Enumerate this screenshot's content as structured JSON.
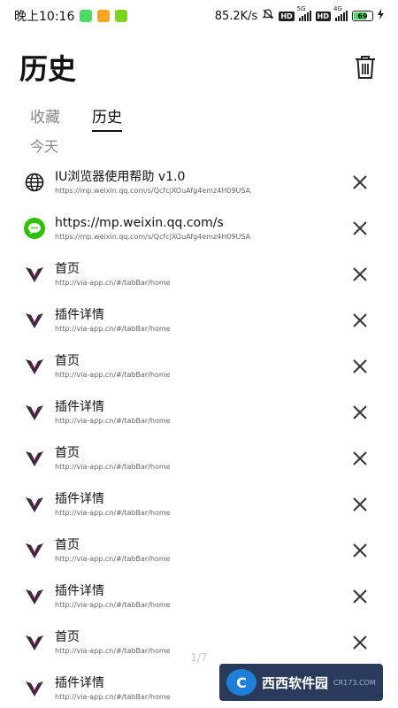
{
  "status_bar": {
    "time": "晚上10:16",
    "net_speed": "85.2K/s",
    "hd1": "HD",
    "sig1_label": "5G",
    "hd2": "HD",
    "sig2_label": "4G",
    "battery_level": 69,
    "battery_text": "69",
    "notif_colors": [
      "#4cd964",
      "#f5a623",
      "#7ed321"
    ]
  },
  "header": {
    "title": "历史",
    "trash_icon": "trash-icon"
  },
  "tabs": [
    {
      "label": "收藏",
      "active": false
    },
    {
      "label": "历史",
      "active": true
    }
  ],
  "section_label": "今天",
  "history": [
    {
      "icon": "globe-icon",
      "title": "IU浏览器使用帮助 v1.0",
      "url": "https://mp.weixin.qq.com/s/QcfcjXOuAfg4emz4H09USA"
    },
    {
      "icon": "wechat-icon",
      "title": "https://mp.weixin.qq.com/s",
      "url": "https://mp.weixin.qq.com/s/QcfcjXOuAfg4emz4H09USA"
    },
    {
      "icon": "via-icon",
      "title": "首页",
      "url": "http://via-app.cn/#/tabBar/home"
    },
    {
      "icon": "via-icon",
      "title": "插件详情",
      "url": "http://via-app.cn/#/tabBar/home"
    },
    {
      "icon": "via-icon",
      "title": "首页",
      "url": "http://via-app.cn/#/tabBar/home"
    },
    {
      "icon": "via-icon",
      "title": "插件详情",
      "url": "http://via-app.cn/#/tabBar/home"
    },
    {
      "icon": "via-icon",
      "title": "首页",
      "url": "http://via-app.cn/#/tabBar/home"
    },
    {
      "icon": "via-icon",
      "title": "插件详情",
      "url": "http://via-app.cn/#/tabBar/home"
    },
    {
      "icon": "via-icon",
      "title": "首页",
      "url": "http://via-app.cn/#/tabBar/home"
    },
    {
      "icon": "via-icon",
      "title": "插件详情",
      "url": "http://via-app.cn/#/tabBar/home"
    },
    {
      "icon": "via-icon",
      "title": "首页",
      "url": "http://via-app.cn/#/tabBar/home"
    },
    {
      "icon": "via-icon",
      "title": "插件详情",
      "url": "http://via-app.cn/#/tabBar/home"
    }
  ],
  "page_indicator": "1/7",
  "watermark": {
    "logo_text": "C",
    "name": "西西软件园",
    "site": "CR173.COM"
  }
}
